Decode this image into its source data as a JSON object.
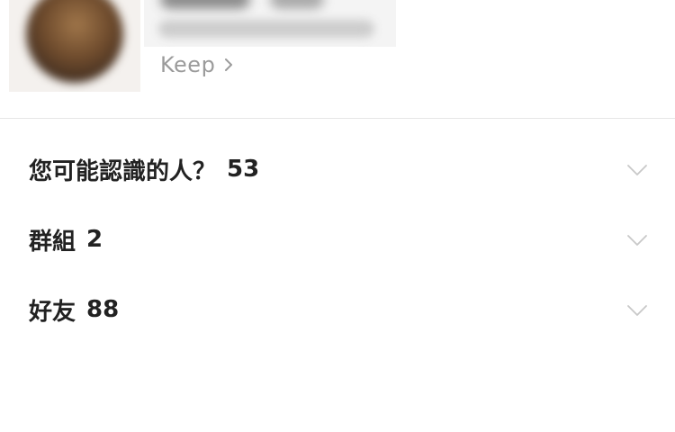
{
  "profile": {
    "avatar_icon": "avatar",
    "keep": {
      "label": "Keep",
      "icon": "chevron-right-icon"
    }
  },
  "sections": [
    {
      "label": "您可能認識的人？",
      "count": "53",
      "icon": "chevron-down-icon"
    },
    {
      "label": "群組",
      "count": "2",
      "icon": "chevron-down-icon"
    },
    {
      "label": "好友",
      "count": "88",
      "icon": "chevron-down-icon"
    }
  ],
  "colors": {
    "text_primary": "#222222",
    "text_secondary": "#9b9b9b",
    "divider": "#e6e6e6",
    "chevron": "#c8c8c8"
  }
}
